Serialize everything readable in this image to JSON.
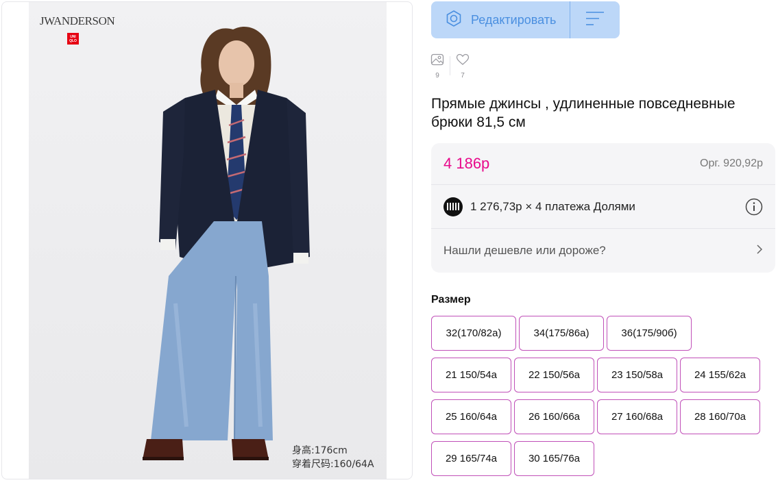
{
  "image": {
    "brand_logo_text": "JWANDERSON",
    "uniqlo_logo_lines": [
      "UNI",
      "QLO"
    ],
    "caption_lines": [
      "身高:176cm",
      "穿着尺码:160/64A"
    ]
  },
  "toolbar": {
    "edit_label": "Редактировать",
    "edit_icon": "hexagon-gear-icon",
    "menu_icon": "sort-lines-icon",
    "accent_color": "#bcd7f8"
  },
  "stats": {
    "photos_count": "9",
    "likes_count": "7"
  },
  "product": {
    "title": "Прямые джинсы , удлиненные повседневные брюки 81,5 см"
  },
  "pricing": {
    "price": "4 186р",
    "original_price": "Орг.  920,92р",
    "price_color": "#e8098b",
    "installment_text": "1 276,73р × 4 платежа Долями",
    "cheaper_link": "Нашли дешевле или дороже?"
  },
  "sizes": {
    "heading": "Размер",
    "row1": [
      "32(170/82а)",
      "34(175/86а)",
      "36(175/90б)"
    ],
    "rows": [
      [
        "21 150/54а",
        "22 150/56а",
        "23 150/58а",
        "24 155/62а"
      ],
      [
        "25 160/64а",
        "26 160/66а",
        "27 160/68а",
        "28 160/70а"
      ],
      [
        "29 165/74а",
        "30 165/76а"
      ]
    ],
    "border_color": "#c04fb8"
  }
}
